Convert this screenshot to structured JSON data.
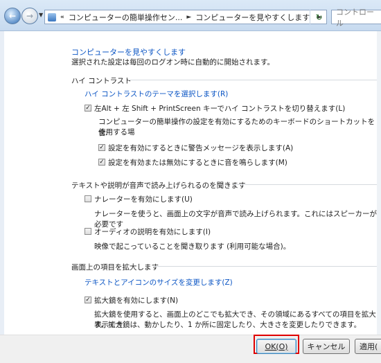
{
  "address_bar": {
    "crumb_1": "コンピューターの簡単操作セン...",
    "crumb_2": "コンピューターを見やすくします",
    "search_placeholder": "コントロール"
  },
  "page": {
    "title": "コンピューターを見やすくします",
    "subtitle": "選択された設定は毎回のログオン時に自動的に開始されます。"
  },
  "high_contrast": {
    "heading": "ハイ コントラスト",
    "theme_link": "ハイ コントラストのテーマを選択します(R)",
    "toggle_label": "左Alt + 左 Shift + PrintScreen キーでハイ コントラストを切り替えます(L)",
    "toggle_checked": true,
    "desc_line1": "コンピューターの簡単操作の設定を有効にするためのキーボードのショートカットを使用する場",
    "desc_line2": "合:",
    "warn_label": "設定を有効にするときに警告メッセージを表示します(A)",
    "warn_checked": true,
    "sound_label": "設定を有効または無効にするときに音を鳴らします(M)",
    "sound_checked": true
  },
  "narration": {
    "heading": "テキストや説明が音声で読み上げられるのを聞きます",
    "narrator_label": "ナレーターを有効にします(U)",
    "narrator_checked": false,
    "narrator_desc": "ナレーターを使うと、画面上の文字が音声で読み上げられます。これにはスピーカーが必要です",
    "audio_label": "オーディオの説明を有効にします(I)",
    "audio_checked": false,
    "audio_desc": "映像で起こっていることを聞き取ります (利用可能な場合)。"
  },
  "magnify": {
    "heading": "画面上の項目を拡大します",
    "size_link": "テキストとアイコンのサイズを変更します(Z)",
    "magnifier_label": "拡大鏡を有効にします(N)",
    "magnifier_checked": true,
    "desc_line1": "拡大鏡を使用すると、画面上のどこでも拡大でき、その領域にあるすべての項目を拡大表示でき",
    "desc_line2": "す。拡大鏡は、動かしたり、1 か所に固定したり、大きさを変更したりできます。"
  },
  "buttons": {
    "ok": "OK(O)",
    "cancel": "キャンセル",
    "apply": "適用("
  },
  "colors": {
    "link": "#0b55c4",
    "highlight": "#e00000"
  }
}
